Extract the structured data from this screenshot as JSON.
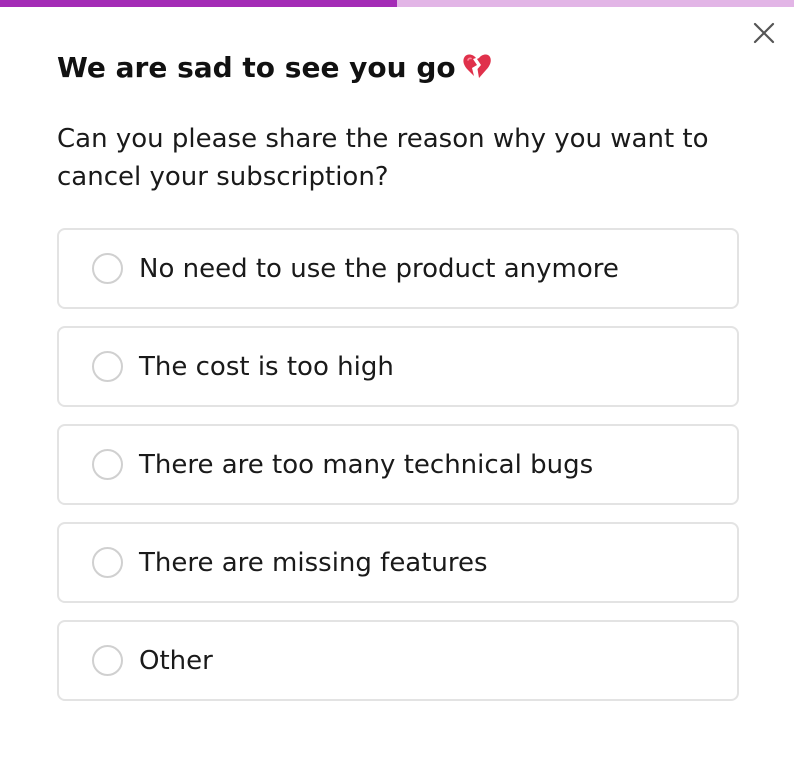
{
  "progress": {
    "fraction": 0.5,
    "fill_color": "#a42cb6",
    "track_color": "#e2b5e6"
  },
  "close": {
    "icon": "close-icon"
  },
  "dialog": {
    "title": "We are sad to see you go",
    "title_icon": "broken-heart-icon",
    "question": "Can you please share the reason why you want to cancel your subscription?"
  },
  "options": [
    {
      "label": "No need to use the product anymore",
      "selected": false
    },
    {
      "label": "The cost is too high",
      "selected": false
    },
    {
      "label": "There are too many technical bugs",
      "selected": false
    },
    {
      "label": "There are missing features",
      "selected": false
    },
    {
      "label": "Other",
      "selected": false
    }
  ]
}
